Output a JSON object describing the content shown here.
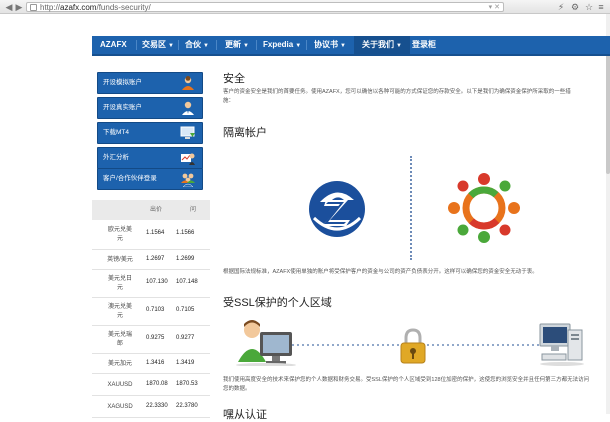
{
  "browser": {
    "url_prefix": "http://",
    "url_host": "azafx.com",
    "url_path": "/funds-security/"
  },
  "nav": {
    "items": [
      {
        "label": "AZAFX",
        "caret": ""
      },
      {
        "label": "交易区",
        "caret": "▼"
      },
      {
        "label": "合伙",
        "caret": "▼"
      },
      {
        "label": "更新",
        "caret": "▼"
      },
      {
        "label": "Fxpedia",
        "caret": "▼"
      },
      {
        "label": "协议书",
        "caret": "▼"
      },
      {
        "label": "关于我们",
        "caret": "▼"
      },
      {
        "label": "登录柜",
        "caret": ""
      }
    ]
  },
  "sidebar": {
    "buttons": [
      {
        "label": "开设模拟账户",
        "icon": "user-add-icon"
      },
      {
        "label": "开设真实账户",
        "icon": "user-icon"
      },
      {
        "label": "下载MT4",
        "icon": "download-computer-icon"
      },
      {
        "label": "外汇分析",
        "icon": "analysis-icon"
      },
      {
        "label": "客户/合作伙伴登录",
        "icon": "group-login-icon"
      }
    ]
  },
  "rates": {
    "col_bid": "出价",
    "col_ask": "问",
    "rows": [
      {
        "name_l1": "欧元兑美",
        "name_l2": "元",
        "bid": "1.1564",
        "ask": "1.1566"
      },
      {
        "name_l1": "英镑/美元",
        "name_l2": "",
        "bid": "1.2697",
        "ask": "1.2699"
      },
      {
        "name_l1": "美元兑日",
        "name_l2": "元",
        "bid": "107.130",
        "ask": "107.148"
      },
      {
        "name_l1": "澳元兑美",
        "name_l2": "元",
        "bid": "0.7103",
        "ask": "0.7105"
      },
      {
        "name_l1": "美元兑瑞",
        "name_l2": "郎",
        "bid": "0.9275",
        "ask": "0.9277"
      },
      {
        "name_l1": "美元加元",
        "name_l2": "",
        "bid": "1.3416",
        "ask": "1.3419"
      },
      {
        "name_l1": "XAUUSD",
        "name_l2": "",
        "bid": "1870.08",
        "ask": "1870.53"
      },
      {
        "name_l1": "XAGUSD",
        "name_l2": "",
        "bid": "22.3330",
        "ask": "22.3780"
      }
    ]
  },
  "content": {
    "title": "安全",
    "intro_l1": "客户的资金安全是我们的首要任务。使用AZAFX，您可以确信以各种可能的方式保证您的存款安全。以下是我们为确保资金保护所采取的一些措",
    "intro_l2": "施：",
    "segregated_title": "隔离帐户",
    "segregated_text": "根据国际法规标准，AZAFX使用单独的账户将受保护客户的资金与公司的资产负债表分开。这样可以确保您的资金安全无动于衷。",
    "ssl_title": "受SSL保护的个人区域",
    "ssl_text_l1": "我们使用高度安全的技术来保护您的个人数据和财务交易。受SSL保护的个人区域受到128位加密的保护，这使您的浏览安全并且任何第三方都无法访问",
    "ssl_text_l2": "您的数据。",
    "next_title": "嘿从认证"
  },
  "colors": {
    "nav_blue": "#1d62ad",
    "logo_blue": "#1b4f9c",
    "orange": "#e8731c",
    "green": "#4aa83a",
    "red": "#d8392b"
  }
}
